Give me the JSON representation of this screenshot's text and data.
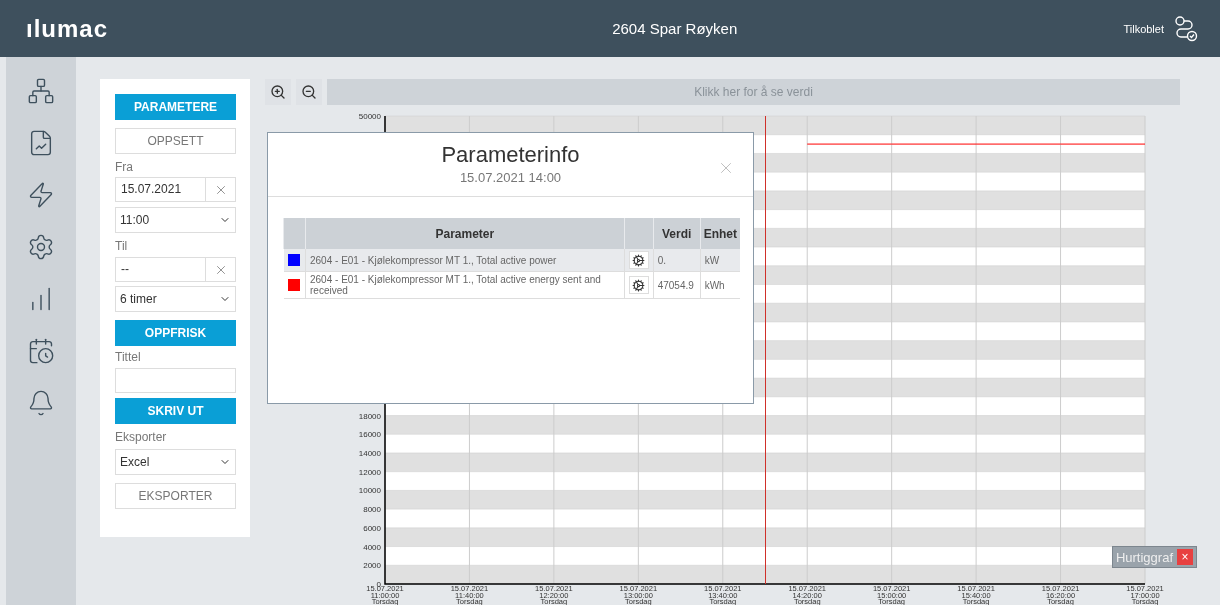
{
  "header": {
    "logo": "ılumac",
    "title": "2604 Spar Røyken",
    "status": "Tilkoblet"
  },
  "panel": {
    "tabs": [
      {
        "label": "PARAMETERE",
        "selected": true
      },
      {
        "label": "OPPSETT",
        "selected": false
      }
    ],
    "from": {
      "label": "Fra",
      "date": "15.07.2021",
      "time": "11:00"
    },
    "to": {
      "label": "Til",
      "date": "--",
      "duration": "6 timer"
    },
    "refresh": "OPPFRISK",
    "title_field": {
      "label": "Tittel"
    },
    "print": "SKRIV UT",
    "export": {
      "label": "Eksporter",
      "format": "Excel",
      "button": "EKSPORTER"
    }
  },
  "toolbar": {
    "value_bar": "Klikk her for å se verdi"
  },
  "chart_data": {
    "type": "line",
    "ylim": [
      0,
      50000
    ],
    "categories": [
      "15.07.2021 11:00:00 Torsdag",
      "15.07.2021 11:40:00 Torsdag",
      "15.07.2021 12:20:00 Torsdag",
      "15.07.2021 13:00:00 Torsdag",
      "15.07.2021 13:40:00 Torsdag",
      "15.07.2021 14:20:00 Torsdag",
      "15.07.2021 15:00:00 Torsdag",
      "15.07.2021 15:40:00 Torsdag",
      "15.07.2021 16:20:00 Torsdag",
      "15.07.2021 17:00:00 Torsdag"
    ],
    "grid": true,
    "bands": [
      {
        "axis": "y",
        "from": 0,
        "to": 2000,
        "color": "#e0e0e0"
      },
      {
        "axis": "y",
        "from": 4000,
        "to": 6000,
        "color": "#e0e0e0"
      },
      {
        "axis": "y",
        "from": 8000,
        "to": 10000,
        "color": "#e0e0e0"
      },
      {
        "axis": "y",
        "from": 12000,
        "to": 14000,
        "color": "#e0e0e0"
      },
      {
        "axis": "y",
        "from": 16000,
        "to": 18000,
        "color": "#e0e0e0"
      },
      {
        "axis": "y",
        "from": 20000,
        "to": 22000,
        "color": "#e0e0e0"
      },
      {
        "axis": "y",
        "from": 24000,
        "to": 26000,
        "color": "#e0e0e0"
      },
      {
        "axis": "y",
        "from": 28000,
        "to": 30000,
        "color": "#e0e0e0"
      },
      {
        "axis": "y",
        "from": 32000,
        "to": 34000,
        "color": "#e0e0e0"
      },
      {
        "axis": "y",
        "from": 36000,
        "to": 38000,
        "color": "#e0e0e0"
      },
      {
        "axis": "y",
        "from": 40000,
        "to": 42000,
        "color": "#e0e0e0"
      },
      {
        "axis": "y",
        "from": 44000,
        "to": 46000,
        "color": "#e0e0e0"
      },
      {
        "axis": "y",
        "from": 48000,
        "to": 50000,
        "color": "#e0e0e0"
      }
    ],
    "series": [
      {
        "color": "#ff0000",
        "values": [
          null,
          null,
          null,
          null,
          null,
          47000,
          47000,
          47000,
          47000,
          47000
        ]
      }
    ],
    "yticks": [
      {
        "value": 0,
        "label": "0"
      },
      {
        "value": 2000,
        "label": "2000"
      },
      {
        "value": 4000,
        "label": "4000"
      },
      {
        "value": 6000,
        "label": "6000"
      },
      {
        "value": 8000,
        "label": "8000"
      },
      {
        "value": 10000,
        "label": "10000"
      },
      {
        "value": 12000,
        "label": "12000"
      },
      {
        "value": 14000,
        "label": "14000"
      },
      {
        "value": 16000,
        "label": "16000"
      },
      {
        "value": 18000,
        "label": "18000"
      },
      {
        "value": 50000,
        "label": "50000"
      }
    ]
  },
  "dialog": {
    "title": "Parameterinfo",
    "subtitle": "15.07.2021 14:00",
    "columns": [
      "Parameter",
      "Verdi",
      "Enhet"
    ],
    "rows": [
      {
        "color": "#0000ff",
        "parameter": "2604 - E01 - Kjølekompressor MT 1., Total active power",
        "value": "0.",
        "unit": "kW"
      },
      {
        "color": "#ff0000",
        "parameter": "2604 - E01 - Kjølekompressor MT 1., Total active energy sent and received",
        "value": "47054.9",
        "unit": "kWh"
      }
    ]
  },
  "quick_graph": {
    "label": "Hurtiggraf",
    "close": "×"
  }
}
